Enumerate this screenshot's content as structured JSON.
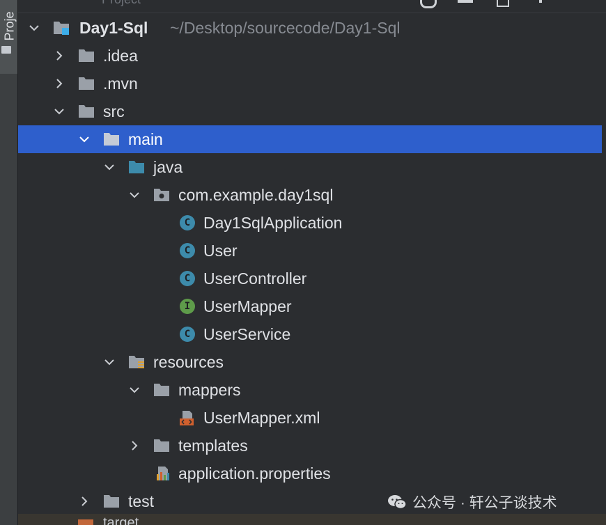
{
  "left_panel": {
    "tab_label": "Proje"
  },
  "topbar": {
    "title": "Project"
  },
  "tree": {
    "rows": [
      {
        "label": "Day1-Sql",
        "hint": "~/Desktop/sourcecode/Day1-Sql"
      },
      {
        "label": ".idea"
      },
      {
        "label": ".mvn"
      },
      {
        "label": "src"
      },
      {
        "label": "main"
      },
      {
        "label": "java"
      },
      {
        "label": "com.example.day1sql"
      },
      {
        "label": "Day1SqlApplication",
        "badge": "C"
      },
      {
        "label": "User",
        "badge": "C"
      },
      {
        "label": "UserController",
        "badge": "C"
      },
      {
        "label": "UserMapper",
        "badge": "I"
      },
      {
        "label": "UserService",
        "badge": "C"
      },
      {
        "label": "resources"
      },
      {
        "label": "mappers"
      },
      {
        "label": "UserMapper.xml"
      },
      {
        "label": "templates"
      },
      {
        "label": "application.properties"
      },
      {
        "label": "test"
      }
    ],
    "partial_bottom": "target"
  },
  "watermark": {
    "text": "公众号 · 轩公子谈技术"
  },
  "colors": {
    "background": "#2b2d30",
    "selection": "#2e5fcc",
    "text": "#dfe1e5",
    "hint": "#868a91",
    "class_badge": "#3d8bab",
    "interface_badge": "#5e9b4a",
    "source_folder": "#3d8bab"
  }
}
